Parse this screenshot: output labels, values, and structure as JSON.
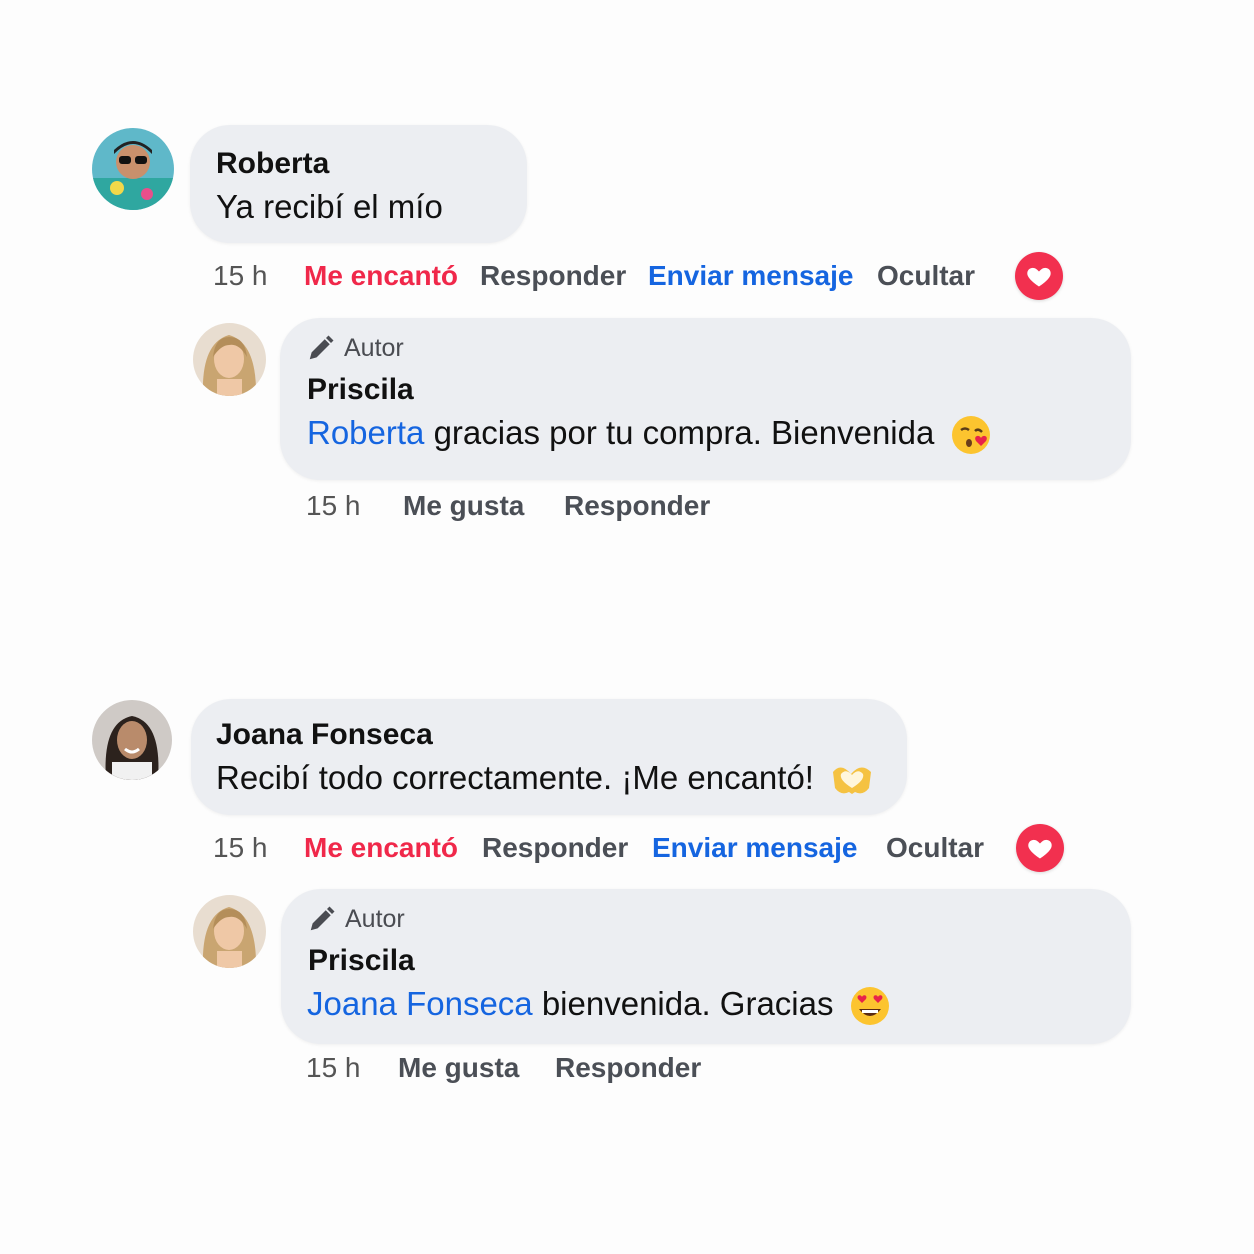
{
  "comments": [
    {
      "author": "Roberta",
      "text": "Ya recibí el mío",
      "time": "15 h",
      "actions": {
        "love": "Me encantó",
        "reply": "Responder",
        "message": "Enviar mensaje",
        "hide": "Ocultar"
      },
      "reaction_icon": "heart-icon",
      "reply": {
        "badge": "Autor",
        "author": "Priscila",
        "mention": "Roberta",
        "text": " gracias por tu compra. Bienvenida",
        "emoji": "kissing-face-heart-emoji",
        "time": "15 h",
        "actions": {
          "like": "Me gusta",
          "reply": "Responder"
        }
      }
    },
    {
      "author": "Joana Fonseca",
      "text": "Recibí todo correctamente. ¡Me encantó!",
      "emoji": "heart-hands-emoji",
      "time": "15 h",
      "actions": {
        "love": "Me encantó",
        "reply": "Responder",
        "message": "Enviar mensaje",
        "hide": "Ocultar"
      },
      "reaction_icon": "heart-icon",
      "reply": {
        "badge": "Autor",
        "author": "Priscila",
        "mention": "Joana Fonseca",
        "text": " bienvenida. Gracias",
        "emoji": "heart-eyes-emoji",
        "time": "15 h",
        "actions": {
          "like": "Me gusta",
          "reply": "Responder"
        }
      }
    }
  ],
  "colors": {
    "bubble": "#eceef2",
    "love": "#f0284a",
    "link": "#1565e0",
    "action": "#4b4f56"
  }
}
